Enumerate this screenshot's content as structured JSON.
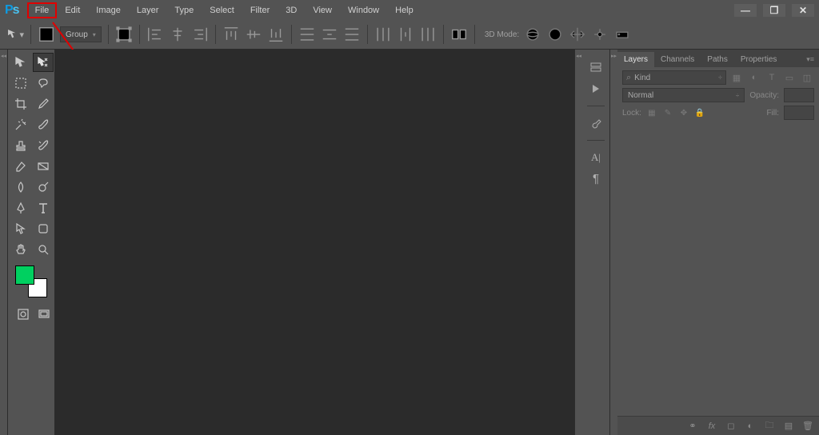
{
  "menu": {
    "items": [
      "File",
      "Edit",
      "Image",
      "Layer",
      "Type",
      "Select",
      "Filter",
      "3D",
      "View",
      "Window",
      "Help"
    ]
  },
  "options": {
    "group_label": "Group",
    "mode3d_label": "3D Mode:"
  },
  "panels": {
    "tabs": [
      "Layers",
      "Channels",
      "Paths",
      "Properties"
    ],
    "kind_label": "Kind",
    "blend_mode": "Normal",
    "opacity_label": "Opacity:",
    "lock_label": "Lock:",
    "fill_label": "Fill:"
  }
}
